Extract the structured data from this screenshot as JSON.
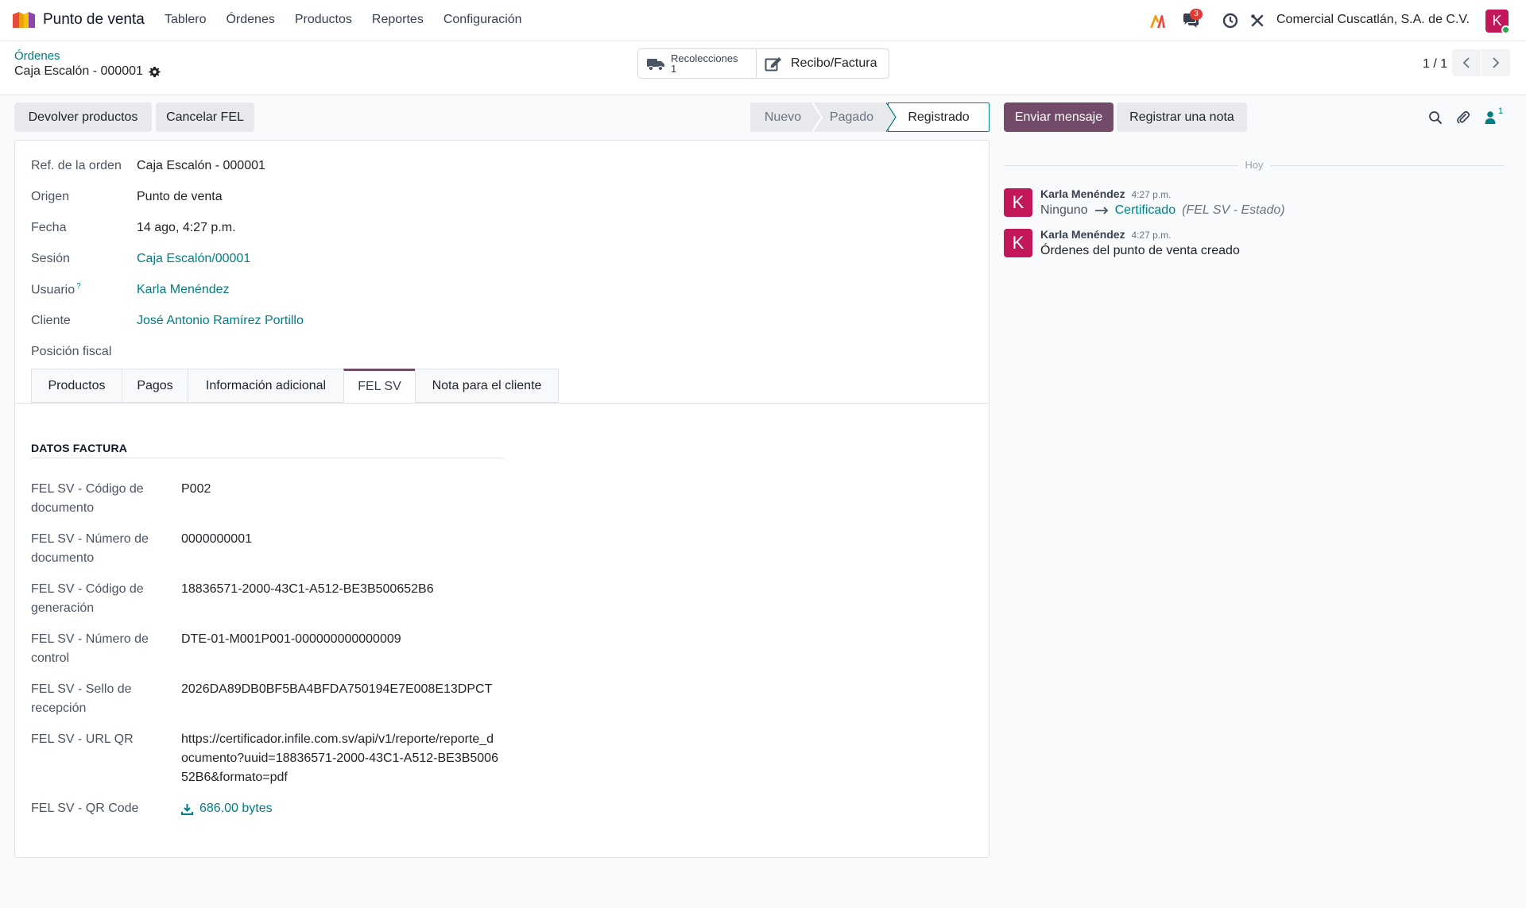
{
  "navbar": {
    "app_name": "Punto de venta",
    "menu": [
      "Tablero",
      "Órdenes",
      "Productos",
      "Reportes",
      "Configuración"
    ],
    "messages_badge": "3",
    "company": "Comercial Cuscatlán, S.A. de C.V.",
    "avatar_letter": "K"
  },
  "breadcrumb": {
    "parent": "Órdenes",
    "current": "Caja Escalón - 000001"
  },
  "smart_buttons": {
    "pickings_title": "Recolecciones",
    "pickings_count": "1",
    "invoice_label": "Recibo/Factura"
  },
  "pager": {
    "value": "1 / 1"
  },
  "actions": {
    "refund": "Devolver productos",
    "cancel_fel": "Cancelar FEL"
  },
  "statusbar": {
    "stages": [
      "Nuevo",
      "Pagado",
      "Registrado"
    ],
    "active": "Registrado"
  },
  "fields": [
    {
      "label": "Ref. de la orden",
      "value": "Caja Escalón - 000001"
    },
    {
      "label": "Origen",
      "value": "Punto de venta"
    },
    {
      "label": "Fecha",
      "value": "14 ago, 4:27 p.m."
    },
    {
      "label": "Sesión",
      "value": "Caja Escalón/00001"
    },
    {
      "label": "Usuario",
      "value": "Karla Menéndez",
      "help": "?"
    },
    {
      "label": "Cliente",
      "value": "José Antonio Ramírez Portillo"
    },
    {
      "label": "Posición fiscal",
      "value": ""
    }
  ],
  "tabs": [
    "Productos",
    "Pagos",
    "Información adicional",
    "FEL SV",
    "Nota para el cliente"
  ],
  "active_tab": "FEL SV",
  "fel_section": {
    "title": "DATOS FACTURA",
    "rows": [
      {
        "label": "FEL SV - Código de documento",
        "value": "P002"
      },
      {
        "label": "FEL SV - Número de documento",
        "value": "0000000001"
      },
      {
        "label": "FEL SV - Código de generación",
        "value": "18836571-2000-43C1-A512-BE3B500652B6"
      },
      {
        "label": "FEL SV - Número de control",
        "value": "DTE-01-M001P001-000000000000009"
      },
      {
        "label": "FEL SV - Sello de recepción",
        "value": "2026DA89DB0BF5BA4BFDA750194E7E008E13DPCT"
      },
      {
        "label": "FEL SV - URL QR",
        "value": "https://certificador.infile.com.sv/api/v1/reporte/reporte_documento?uuid=18836571-2000-43C1-A512-BE3B500652B6&formato=pdf"
      },
      {
        "label": "FEL SV - QR Code",
        "value": "686.00 bytes"
      }
    ]
  },
  "chatter": {
    "send_message": "Enviar mensaje",
    "log_note": "Registrar una nota",
    "followers_count": "1",
    "date_separator": "Hoy",
    "messages": [
      {
        "avatar": "K",
        "author": "Karla Menéndez",
        "time": "4:27 p.m.",
        "old_value": "Ninguno",
        "new_value": "Certificado",
        "field": "(FEL SV - Estado)"
      },
      {
        "avatar": "K",
        "author": "Karla Menéndez",
        "time": "4:27 p.m.",
        "body": "Órdenes del punto de venta creado"
      }
    ]
  },
  "colors": {
    "brand": "#714b67",
    "link": "#017e84",
    "avatar": "#c2185b"
  }
}
